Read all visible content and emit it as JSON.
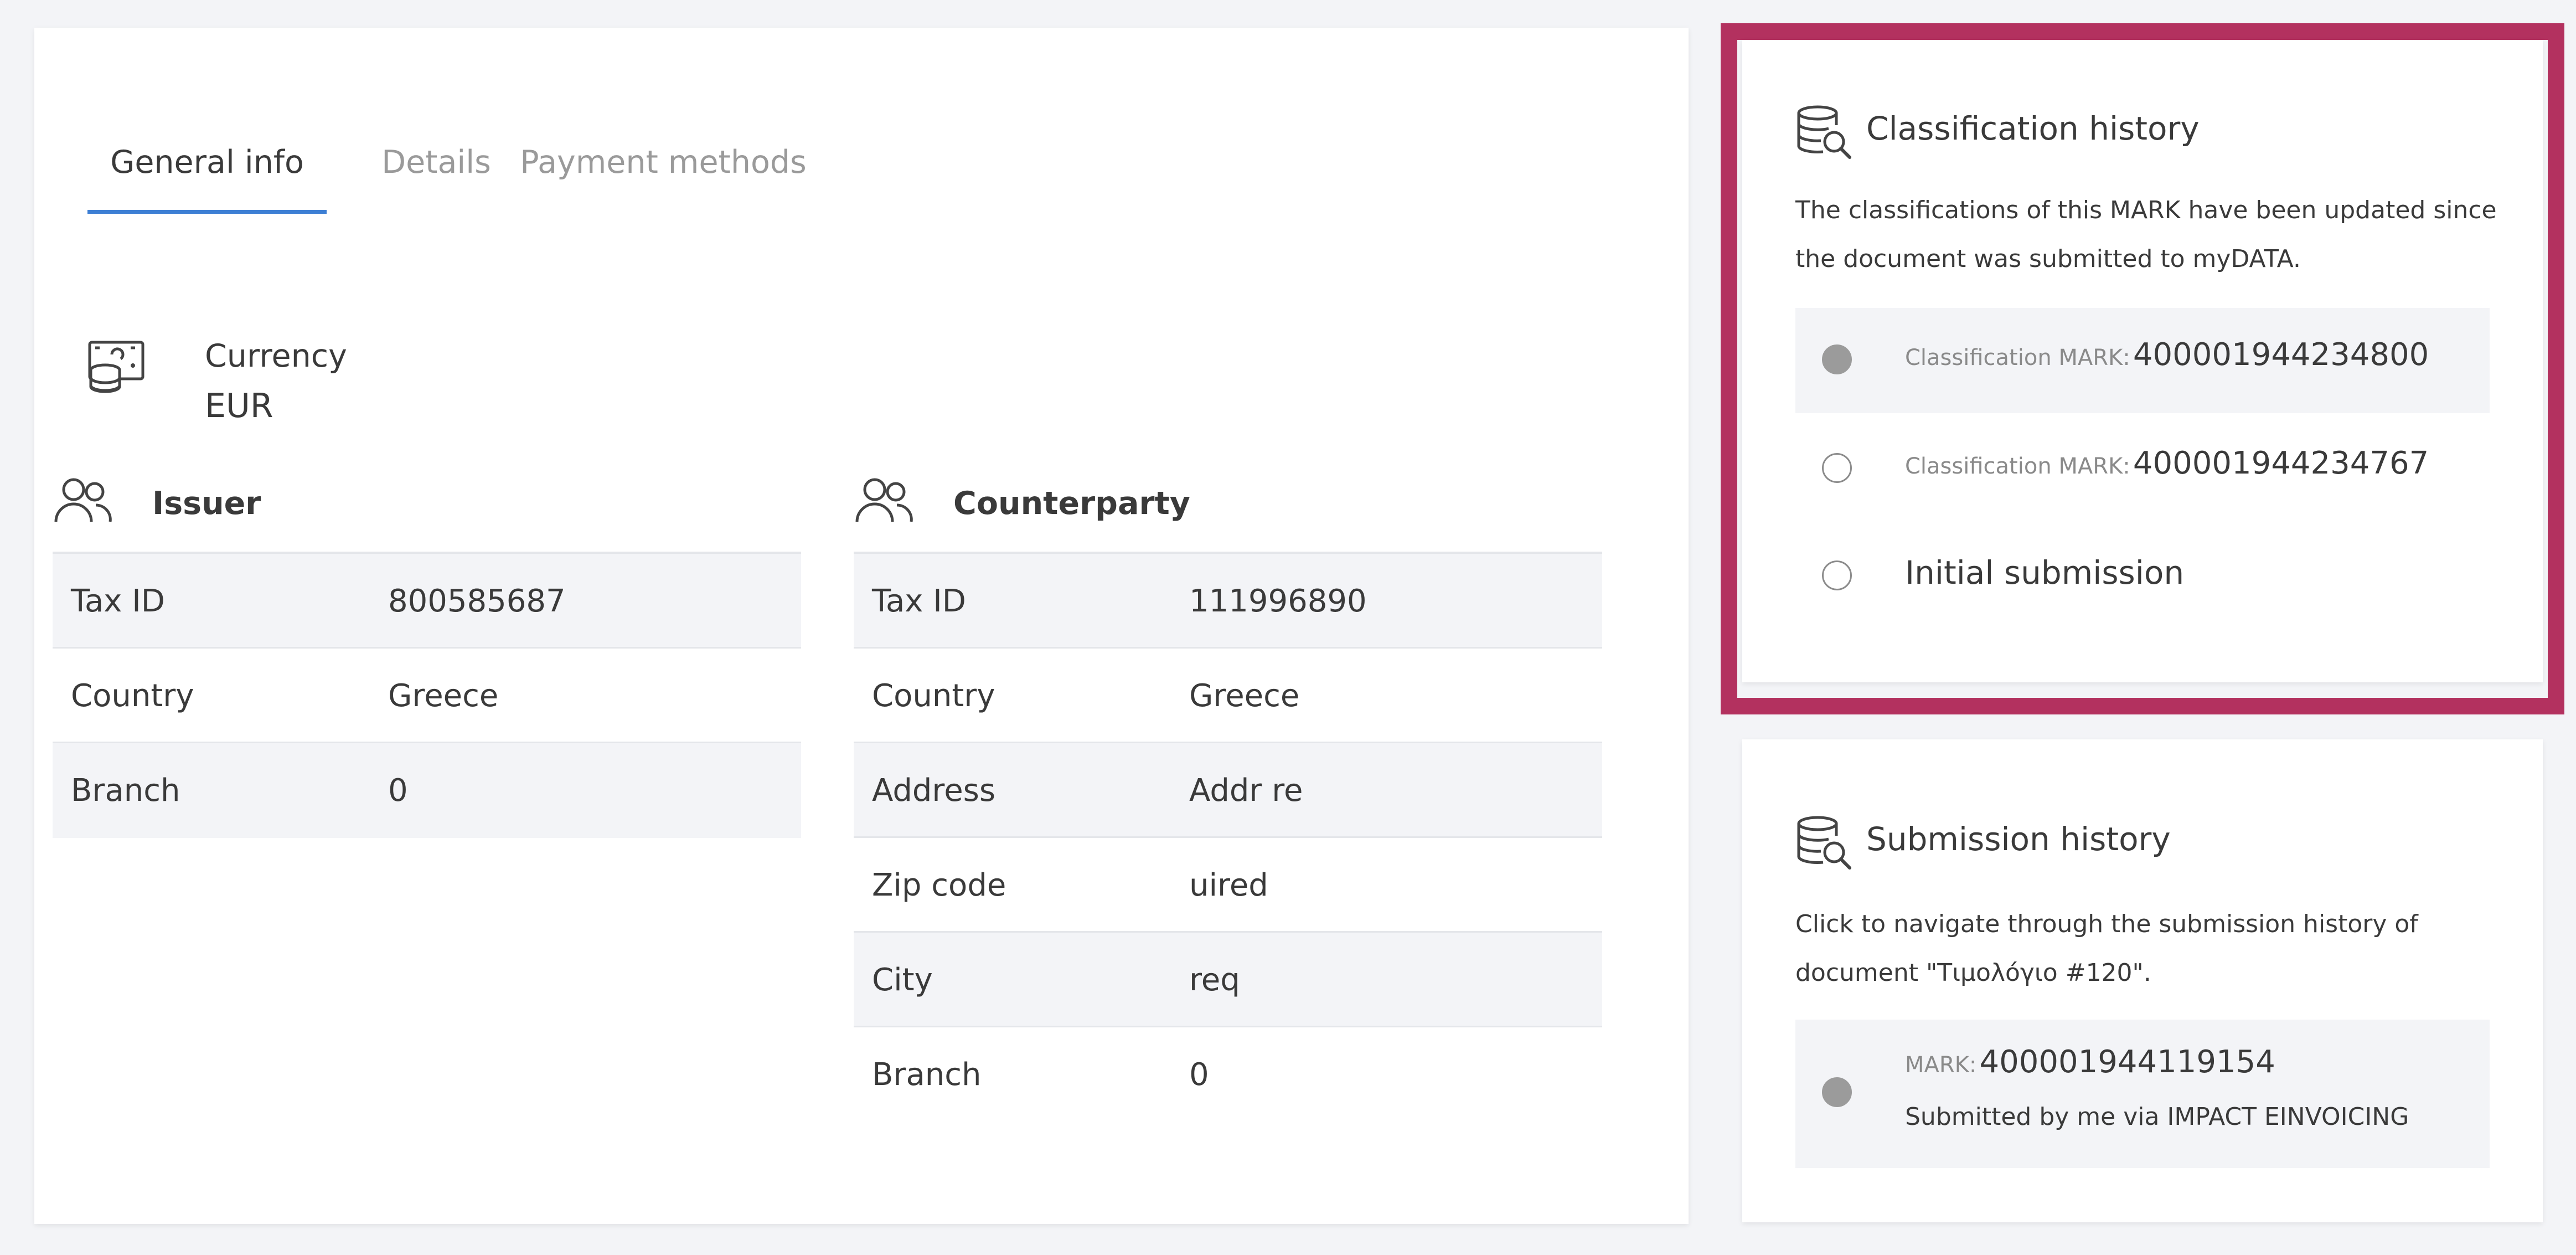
{
  "tabs": {
    "general": "General info",
    "details": "Details",
    "payment": "Payment methods"
  },
  "currency": {
    "label": "Currency",
    "value": "EUR"
  },
  "issuer": {
    "title": "Issuer",
    "rows": [
      {
        "key": "Tax ID",
        "value": "800585687"
      },
      {
        "key": "Country",
        "value": "Greece"
      },
      {
        "key": "Branch",
        "value": "0"
      }
    ]
  },
  "counterparty": {
    "title": "Counterparty",
    "rows": [
      {
        "key": "Tax ID",
        "value": "111996890"
      },
      {
        "key": "Country",
        "value": "Greece"
      },
      {
        "key": "Address",
        "value": "Addr re"
      },
      {
        "key": "Zip code",
        "value": "uired"
      },
      {
        "key": "City",
        "value": "req"
      },
      {
        "key": "Branch",
        "value": "0"
      }
    ]
  },
  "classification_history": {
    "title": "Classification history",
    "description": "The classifications of this MARK have been updated since the document was submitted to myDATA.",
    "items": [
      {
        "label": "Classification MARK:",
        "mark": "400001944234800",
        "selected": true
      },
      {
        "label": "Classification MARK:",
        "mark": "400001944234767",
        "selected": false
      },
      {
        "text": "Initial submission",
        "selected": false
      }
    ]
  },
  "submission_history": {
    "title": "Submission history",
    "description": "Click to navigate through the submission history of document \"Τιμολόγιο #120\".",
    "items": [
      {
        "label": "MARK:",
        "mark": "400001944119154",
        "note": "Submitted by me via IMPACT EINVOICING",
        "selected": true
      }
    ]
  },
  "colors": {
    "highlight_border": "#b3315f",
    "active_tab_underline": "#3d7fd4",
    "page_background": "#f3f4f7"
  }
}
